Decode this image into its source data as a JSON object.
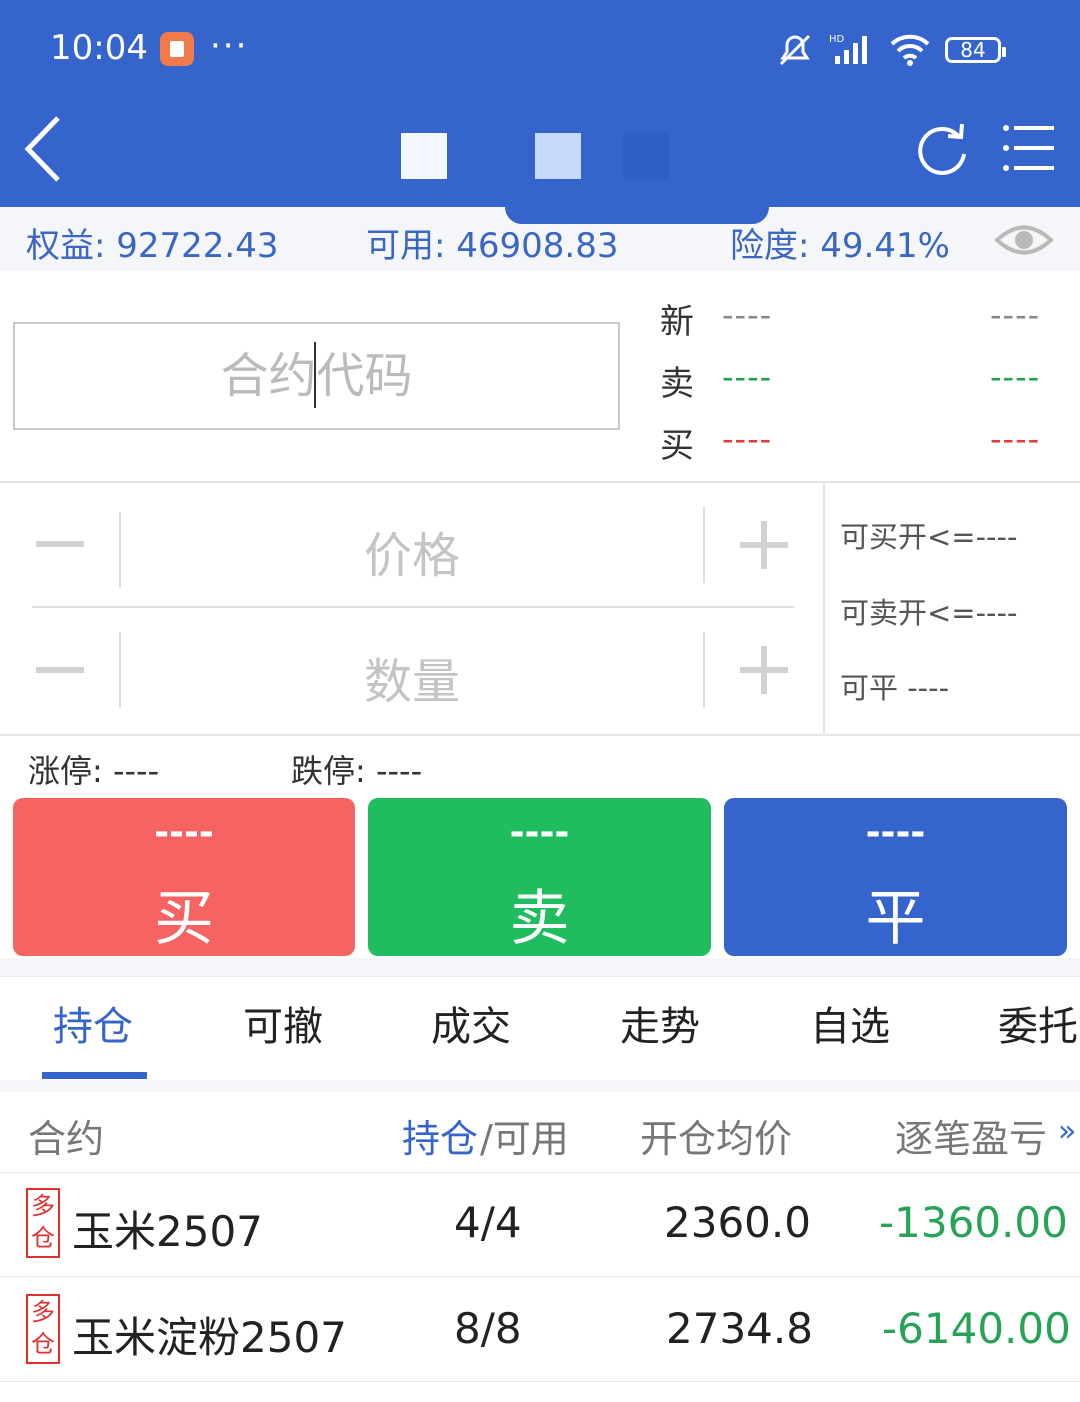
{
  "status_bar": {
    "time": "10:04",
    "dots": "···",
    "battery": "84"
  },
  "account": {
    "equity": "权益: 92722.43",
    "available": "可用: 46908.83",
    "risk": "险度:  49.41%"
  },
  "contract_input": {
    "placeholder": "合约代码"
  },
  "quotes": {
    "latest": {
      "label": "新",
      "left": "----",
      "right": "----"
    },
    "ask": {
      "label": "卖",
      "left": "----",
      "right": "----"
    },
    "bid": {
      "label": "买",
      "left": "----",
      "right": "----"
    }
  },
  "price_field": {
    "placeholder": "价格"
  },
  "qty_field": {
    "placeholder": "数量"
  },
  "side_info": {
    "can_buy_open": "可买开<=----",
    "can_sell_open": "可卖开<=----",
    "can_close": "可平  ----"
  },
  "limits": {
    "up": "涨停: ----",
    "down": "跌停: ----"
  },
  "buttons": {
    "buy": {
      "price": "----",
      "label": "买"
    },
    "sell": {
      "price": "----",
      "label": "卖"
    },
    "close": {
      "price": "----",
      "label": "平"
    }
  },
  "tabs": [
    "持仓",
    "可撤",
    "成交",
    "走势",
    "自选",
    "委托"
  ],
  "table": {
    "headers": {
      "contract": "合约",
      "position_a": "持仓",
      "position_b": "/可用",
      "avg_price": "开仓均价",
      "pnl": "逐笔盈亏",
      "more": "»"
    },
    "rows": [
      {
        "badge_top": "多",
        "badge_bottom": "仓",
        "name": "玉米2507",
        "pos": "4",
        "sep": "/",
        "avail": "4",
        "avg": "2360.0",
        "pnl": "-1360.00"
      },
      {
        "badge_top": "多",
        "badge_bottom": "仓",
        "name": "玉米淀粉2507",
        "pos": "8",
        "sep": "/",
        "avail": "8",
        "avg": "2734.8",
        "pnl": "-6140.00"
      }
    ]
  },
  "colors": {
    "primary": "#3565cc",
    "buy": "#f56363",
    "sell": "#20bd5f",
    "loss_green": "#26a356",
    "badge_red": "#e03030"
  }
}
